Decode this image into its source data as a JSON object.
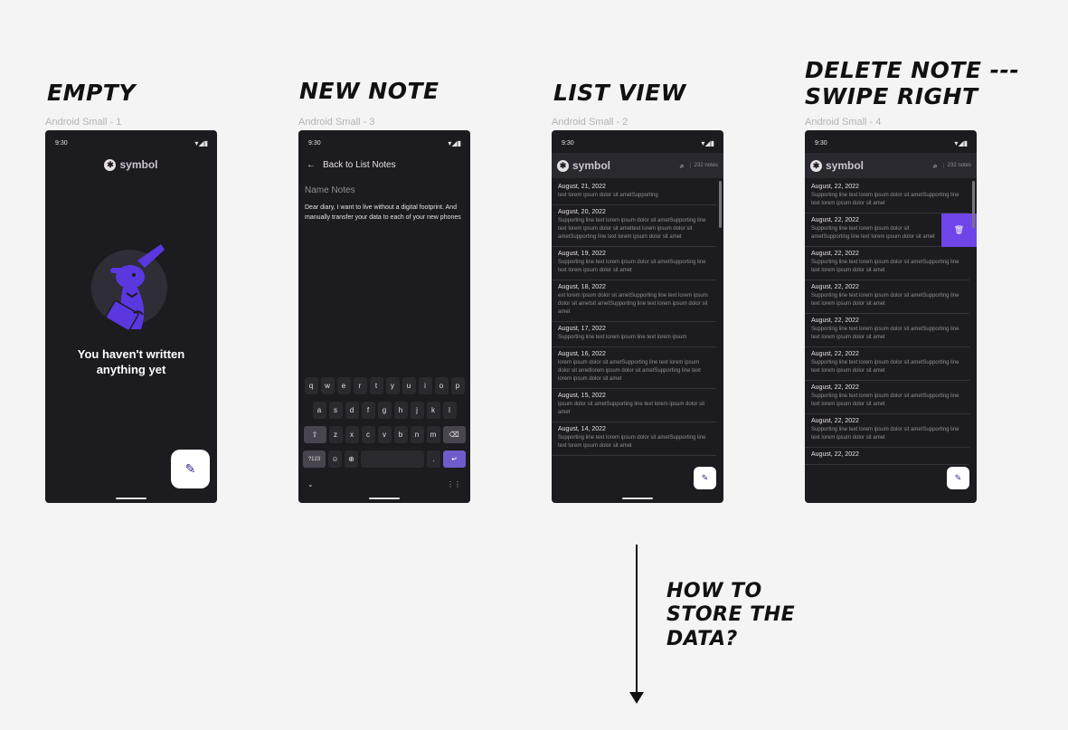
{
  "headings": {
    "empty": "Empty",
    "new_note": "New note",
    "list_view": "List view",
    "delete_line1": "Delete note ---",
    "delete_line2": "swipe right"
  },
  "frame_labels": {
    "empty": "Android Small - 1",
    "new_note": "Android Small - 3",
    "list_view": "Android Small - 2",
    "delete": "Android Small - 4"
  },
  "status": {
    "time": "9:30"
  },
  "brand": {
    "name": "symbol"
  },
  "empty_screen": {
    "message": "You haven't written\nanything yet"
  },
  "new_note_screen": {
    "back_label": "Back to List Notes",
    "title_placeholder": "Name Notes",
    "body": "Dear diary, I want to live without a digital footprint. And manually transfer your data to each of your new phones"
  },
  "keyboard": {
    "row1": [
      "q",
      "w",
      "e",
      "r",
      "t",
      "y",
      "u",
      "i",
      "o",
      "p"
    ],
    "row2": [
      "a",
      "s",
      "d",
      "f",
      "g",
      "h",
      "j",
      "k",
      "l"
    ],
    "row3": [
      "z",
      "x",
      "c",
      "v",
      "b",
      "n",
      "m"
    ],
    "symbols_key": "?123",
    "period_key": "."
  },
  "list_screen": {
    "count": "232 notes",
    "items": [
      {
        "date": "August, 21, 2022",
        "text": "text lorem ipsum dolor sit ametSupporting"
      },
      {
        "date": "August, 20, 2022",
        "text": "Supporting line text lorem ipsum dolor sit ametSupporting line text lorem ipsum dolor sit amettext lorem ipsum dolor sit ametSupporting line text lorem ipsum dolor sit amet"
      },
      {
        "date": "August, 19, 2022",
        "text": "Supporting line text lorem ipsum dolor sit ametSupporting line text lorem ipsum dolor sit amet"
      },
      {
        "date": "August, 18, 2022",
        "text": "ext lorem ipsum dolor sit ametSupporting line text lorem ipsum dolor sit ametsit ametSupporting line text lorem ipsum dolor sit amet"
      },
      {
        "date": "August, 17, 2022",
        "text": "Supporting line text lorem ipsum line text lorem ipsum"
      },
      {
        "date": "August, 16, 2022",
        "text": "lorem ipsum dolor sit ametSupporting line text lorem ipsum dolor sit ametlorem ipsum dolor sit ametSupporting line text lorem ipsum dolor sit amet"
      },
      {
        "date": "August, 15, 2022",
        "text": "ipsum dolor sit ametSupporting line text lorem ipsum dolor sit amet"
      },
      {
        "date": "August, 14, 2022",
        "text": "Supporting line text lorem ipsum dolor sit ametSupporting line text lorem ipsum dolor sit amet"
      }
    ]
  },
  "delete_screen": {
    "count": "232 notes",
    "items": [
      {
        "date": "August, 22, 2022",
        "text": "Supporting line text lorem ipsum dolor sit ametSupporting line text lorem ipsum dolor sit amet"
      },
      {
        "date": "August, 22, 2022",
        "text": "Supporting line text lorem ipsum dolor sit ametSupporting line text lorem ipsum dolor sit amet"
      },
      {
        "date": "August, 22, 2022",
        "text": "Supporting line text lorem ipsum dolor sit ametSupporting line text lorem ipsum dolor sit amet"
      },
      {
        "date": "August, 22, 2022",
        "text": "Supporting line text lorem ipsum dolor sit ametSupporting line text lorem ipsum dolor sit amet"
      },
      {
        "date": "August, 22, 2022",
        "text": "Supporting line text lorem ipsum dolor sit ametSupporting line text lorem ipsum dolor sit amet"
      },
      {
        "date": "August, 22, 2022",
        "text": "Supporting line text lorem ipsum dolor sit ametSupporting line text lorem ipsum dolor sit amet"
      },
      {
        "date": "August, 22, 2022",
        "text": "Supporting line text lorem ipsum dolor sit ametSupporting line text lorem ipsum dolor sit amet"
      },
      {
        "date": "August, 22, 2022",
        "text": "Supporting line text lorem ipsum dolor sit ametSupporting line text lorem ipsum dolor sit amet"
      },
      {
        "date": "August, 22, 2022",
        "text": ""
      }
    ]
  },
  "annotation": {
    "question": "How to\nstore the\ndata?"
  },
  "colors": {
    "accent": "#6f45e9",
    "surface": "#1c1b1f",
    "canvas": "#f4f4f4"
  },
  "icons": [
    "pencil-icon",
    "search-icon",
    "back-arrow-icon",
    "delete-icon",
    "globe-icon",
    "backspace-icon",
    "shift-icon",
    "enter-icon"
  ]
}
